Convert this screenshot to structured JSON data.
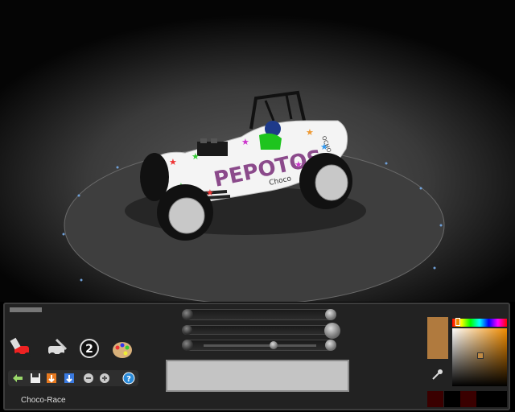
{
  "profile_name": "Choco-Race",
  "car": {
    "decal_text_main": "PEPOTOS",
    "decal_text_small": "Choco",
    "side_text": "OCHO"
  },
  "colors": {
    "selected": "#b07a3e",
    "recent": [
      "#3a0000",
      "#000000",
      "#3a0000",
      "#000000"
    ]
  },
  "icons": {
    "paint": "paint-car-icon",
    "decal": "decal-icon",
    "number": "number-plate-icon",
    "palette": "palette-icon",
    "undo": "undo-icon",
    "save": "save-icon",
    "load": "load-icon",
    "redo": "redo-icon",
    "zoom_out": "zoom-out-icon",
    "zoom_in": "zoom-in-icon",
    "help": "help-icon",
    "eyedropper": "eyedropper-icon"
  },
  "number_plate": "2",
  "sliders": {
    "size": 1.0,
    "rotation": 1.0,
    "transparency": 0.6
  }
}
